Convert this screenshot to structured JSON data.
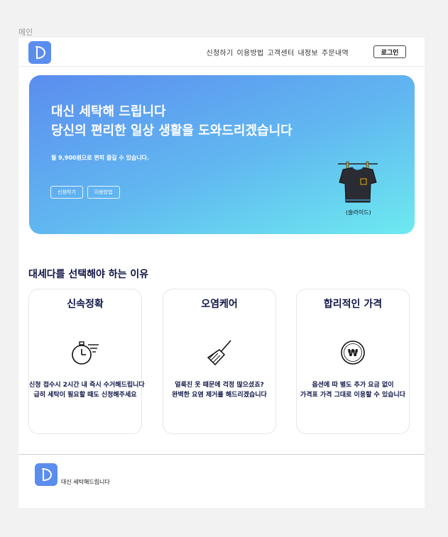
{
  "frame_label": "메인",
  "header": {
    "logo_letter": "D",
    "nav": [
      "신청하기",
      "이용방법",
      "고객센터",
      "내정보",
      "주문내역"
    ],
    "login_label": "로그인"
  },
  "hero": {
    "title_line1": "대신 세탁해 드립니다",
    "title_line2": "당신의 편리한 일상 생활을 도와드리겠습니다",
    "subtitle": "월 9,900원으로 편히 즐길 수 있습니다.",
    "buttons": [
      "신청하기",
      "이용방법"
    ],
    "slide_label": "(슬라이드)"
  },
  "reasons": {
    "title": "대세다를 선택해야 하는 이유",
    "cards": [
      {
        "title": "신속정확",
        "icon": "stopwatch-icon",
        "lines": [
          "신청 접수시 2시간 내 즉시 수거해드립니다",
          "급히 세탁이 필요할 때도 신청해주세요"
        ]
      },
      {
        "title": "오염케어",
        "icon": "broom-icon",
        "lines": [
          "얼룩진 옷 때문에 걱정 많으셨죠?",
          "완벽한 요염 제거를 해드리겠습니다"
        ]
      },
      {
        "title": "합리적인 가격",
        "icon": "won-coin-icon",
        "lines": [
          "옵션에 따 별도 추가 요금 없이",
          "가격표 가격 그대로 이용할 수 있습니다"
        ]
      }
    ]
  },
  "footer": {
    "text": "대신 세탁해드립니다"
  },
  "colors": {
    "brand": "#5b8def",
    "hero_end": "#6deaf0",
    "heading": "#0f1546"
  }
}
